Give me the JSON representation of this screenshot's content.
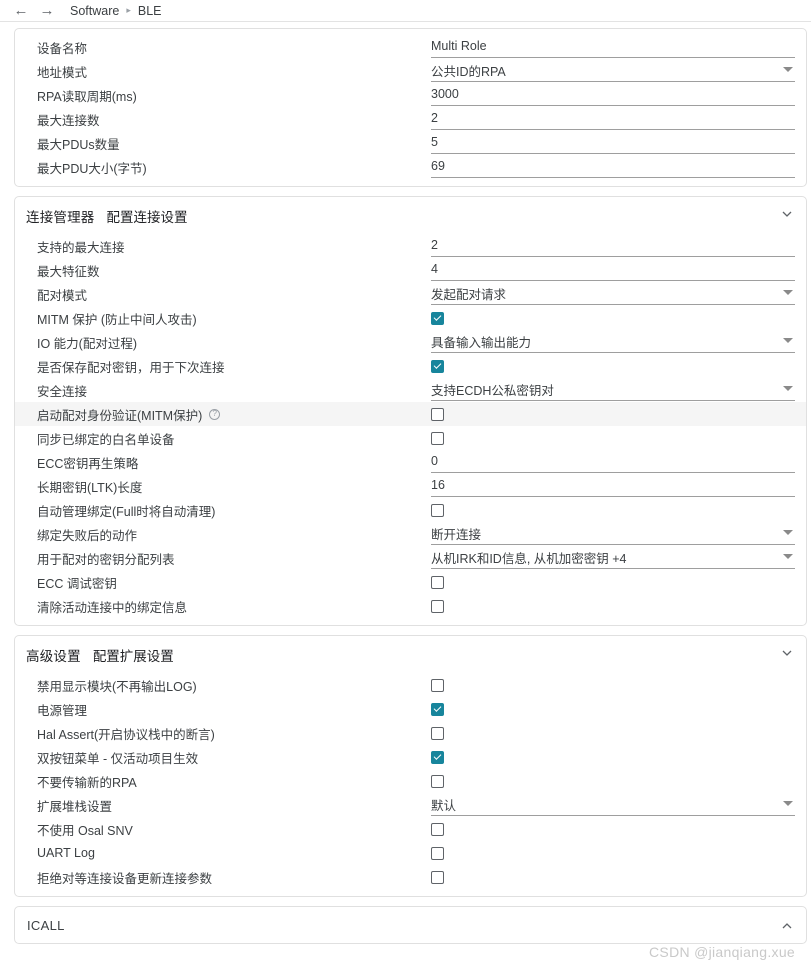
{
  "nav": {
    "back_icon": "arrow-left-icon",
    "forward_icon": "arrow-right-icon",
    "breadcrumb": [
      {
        "label": "Software"
      },
      {
        "label": "BLE"
      }
    ],
    "separator": "▸"
  },
  "colors": {
    "accent": "#17859c",
    "text": "#3c4043",
    "border": "#e0e0e0",
    "underline": "#9e9e9e",
    "highlight_row": "#f5f5f5",
    "watermark": "#c9c9c9"
  },
  "sections": [
    {
      "title": "",
      "subtitle": "",
      "has_header": false,
      "rows": [
        {
          "label": "设备名称",
          "type": "text",
          "value": "Multi Role"
        },
        {
          "label": "地址模式",
          "type": "select",
          "value": "公共ID的RPA"
        },
        {
          "label": "RPA读取周期(ms)",
          "type": "text",
          "value": "3000"
        },
        {
          "label": "最大连接数",
          "type": "text",
          "value": "2"
        },
        {
          "label": "最大PDUs数量",
          "type": "text",
          "value": "5"
        },
        {
          "label": "最大PDU大小(字节)",
          "type": "text",
          "value": "69"
        }
      ]
    },
    {
      "title": "连接管理器",
      "subtitle": "配置连接设置",
      "has_header": true,
      "chevron": "chevron-down-icon",
      "rows": [
        {
          "label": "支持的最大连接",
          "type": "text",
          "value": "2"
        },
        {
          "label": "最大特征数",
          "type": "text",
          "value": "4"
        },
        {
          "label": "配对模式",
          "type": "select",
          "value": "发起配对请求"
        },
        {
          "label": "MITM 保护 (防止中间人攻击)",
          "type": "checkbox",
          "checked": true
        },
        {
          "label": "IO 能力(配对过程)",
          "type": "select",
          "value": "具备输入输出能力"
        },
        {
          "label": "是否保存配对密钥，用于下次连接",
          "type": "checkbox",
          "checked": true
        },
        {
          "label": "安全连接",
          "type": "select",
          "value": "支持ECDH公私密钥对"
        },
        {
          "label": "启动配对身份验证(MITM保护)",
          "type": "checkbox",
          "checked": false,
          "info": true,
          "highlight": true
        },
        {
          "label": "同步已绑定的白名单设备",
          "type": "checkbox",
          "checked": false
        },
        {
          "label": "ECC密钥再生策略",
          "type": "text",
          "value": "0"
        },
        {
          "label": "长期密钥(LTK)长度",
          "type": "text",
          "value": "16"
        },
        {
          "label": "自动管理绑定(Full时将自动清理)",
          "type": "checkbox",
          "checked": false
        },
        {
          "label": "绑定失败后的动作",
          "type": "select",
          "value": "断开连接"
        },
        {
          "label": "用于配对的密钥分配列表",
          "type": "select",
          "value": "从机IRK和ID信息, 从机加密密钥 +4"
        },
        {
          "label": "ECC 调试密钥",
          "type": "checkbox",
          "checked": false
        },
        {
          "label": "清除活动连接中的绑定信息",
          "type": "checkbox",
          "checked": false
        }
      ]
    },
    {
      "title": "高级设置",
      "subtitle": "配置扩展设置",
      "has_header": true,
      "chevron": "chevron-down-icon",
      "rows": [
        {
          "label": "禁用显示模块(不再输出LOG)",
          "type": "checkbox",
          "checked": false
        },
        {
          "label": "电源管理",
          "type": "checkbox",
          "checked": true
        },
        {
          "label": "Hal Assert(开启协议栈中的断言)",
          "type": "checkbox",
          "checked": false
        },
        {
          "label": "双按钮菜单 - 仅活动项目生效",
          "type": "checkbox",
          "checked": true
        },
        {
          "label": "不要传输新的RPA",
          "type": "checkbox",
          "checked": false
        },
        {
          "label": "扩展堆栈设置",
          "type": "select",
          "value": "默认"
        },
        {
          "label": "不使用 Osal SNV",
          "type": "checkbox",
          "checked": false
        },
        {
          "label": "UART Log",
          "type": "checkbox",
          "checked": false
        },
        {
          "label": "拒绝对等连接设备更新连接参数",
          "type": "checkbox",
          "checked": false
        }
      ]
    }
  ],
  "footer_section": {
    "title": "ICALL",
    "chevron": "chevron-up-icon"
  },
  "watermark": "CSDN @jianqiang.xue"
}
